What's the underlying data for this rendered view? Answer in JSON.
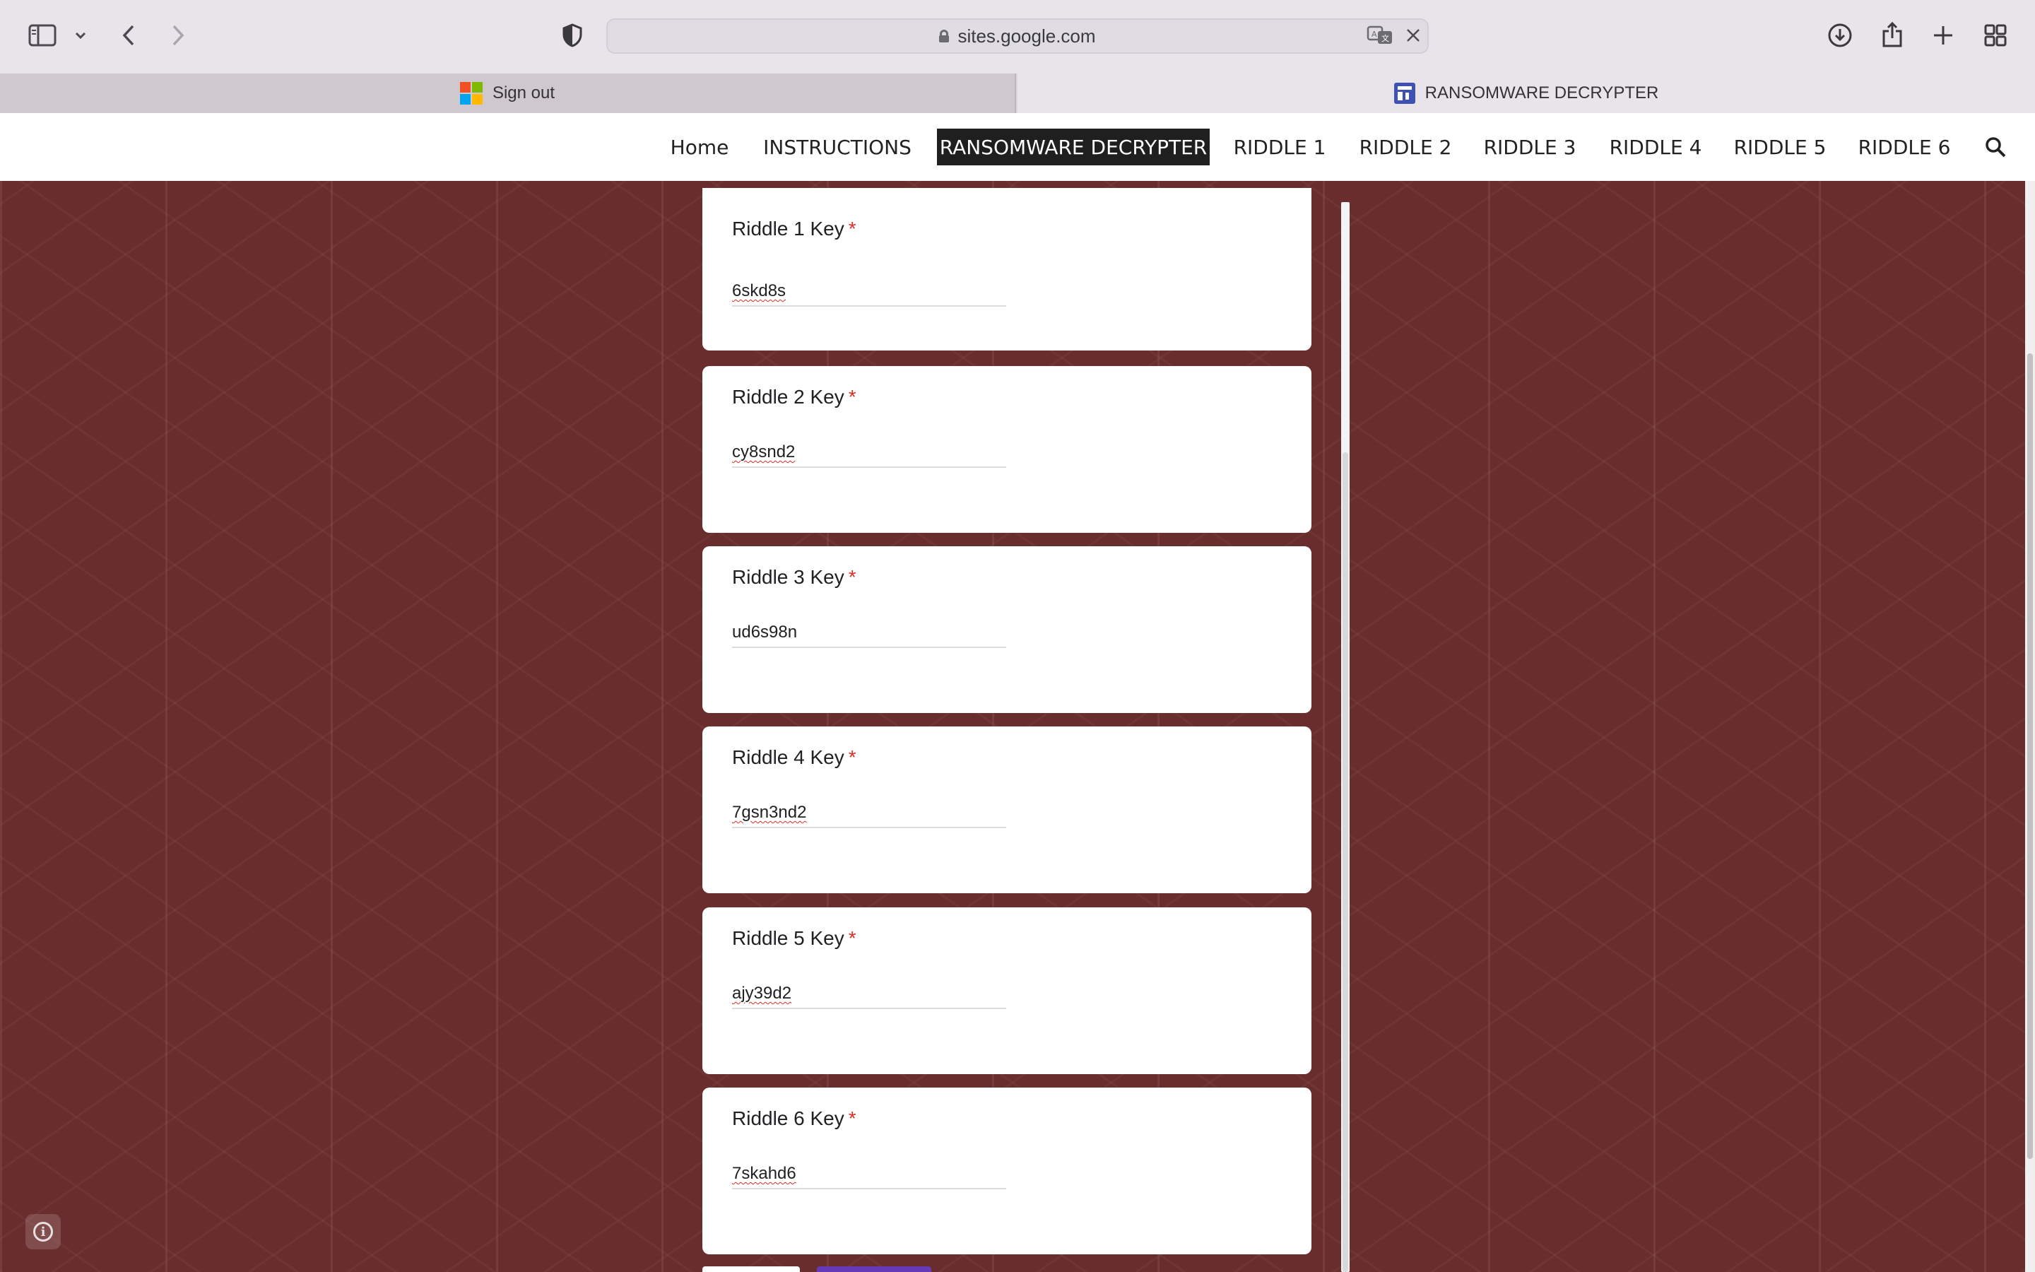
{
  "browser": {
    "url": "sites.google.com",
    "tabs": [
      {
        "label": "Sign out",
        "icon": "microsoft-logo-icon"
      },
      {
        "label": "RANSOMWARE DECRYPTER",
        "icon": "google-sites-icon"
      }
    ]
  },
  "nav": {
    "items": [
      {
        "label": "Home"
      },
      {
        "label": "INSTRUCTIONS"
      },
      {
        "label": "RANSOMWARE DECRYPTER",
        "active": true
      },
      {
        "label": "RIDDLE 1"
      },
      {
        "label": "RIDDLE 2"
      },
      {
        "label": "RIDDLE 3"
      },
      {
        "label": "RIDDLE 4"
      },
      {
        "label": "RIDDLE 5"
      },
      {
        "label": "RIDDLE 6"
      }
    ]
  },
  "form": {
    "required_marker": "*",
    "fields": [
      {
        "label": "Riddle 1 Key",
        "value": "6skd8s"
      },
      {
        "label": "Riddle 2 Key",
        "value": "cy8snd2"
      },
      {
        "label": "Riddle 3 Key",
        "value": "ud6s98n"
      },
      {
        "label": "Riddle 4 Key",
        "value": "7gsn3nd2"
      },
      {
        "label": "Riddle 5 Key",
        "value": "ajy39d2"
      },
      {
        "label": "Riddle 6 Key",
        "value": "7skahd6"
      }
    ]
  },
  "colors": {
    "page_background": "#6a2d2d",
    "nav_active": "#1f1f1f",
    "required": "#d93025",
    "submit_button": "#673ab7"
  }
}
